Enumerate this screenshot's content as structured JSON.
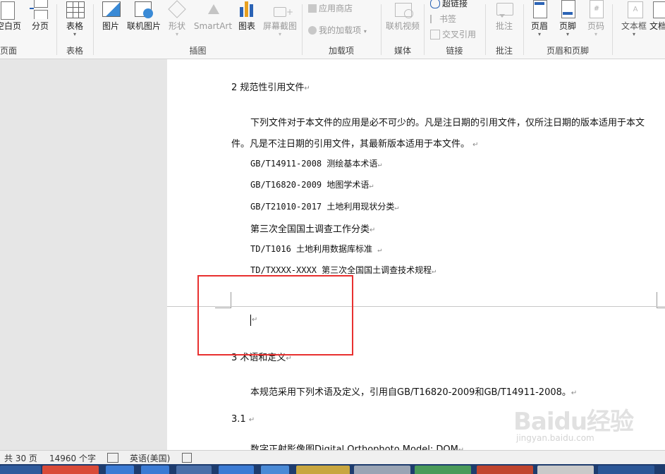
{
  "ribbon": {
    "groups": {
      "pages": {
        "label": "页面",
        "blank_page": "空白页",
        "page_break": "分页"
      },
      "table": {
        "label": "表格",
        "table": "表格"
      },
      "illustrations": {
        "label": "插图",
        "picture": "图片",
        "online_picture": "联机图片",
        "shapes": "形状",
        "smartart": "SmartArt",
        "chart": "图表",
        "screenshot": "屏幕截图"
      },
      "addins": {
        "label": "加载项",
        "store": "应用商店",
        "my_addins": "我的加载项"
      },
      "media": {
        "label": "媒体",
        "online_video": "联机视频"
      },
      "links": {
        "label": "链接",
        "hyperlink": "超链接",
        "bookmark": "书签",
        "cross_reference": "交叉引用"
      },
      "comments": {
        "label": "批注",
        "comment": "批注"
      },
      "header_footer": {
        "label": "页眉和页脚",
        "header": "页眉",
        "footer": "页脚",
        "page_number": "页码"
      },
      "text": {
        "textbox": "文本框",
        "text_more": "文档"
      }
    }
  },
  "document": {
    "section2_heading": "2  规范性引用文件",
    "para1_line1": "下列文件对于本文件的应用是必不可少的。凡是注日期的引用文件，仅所注日期的版本适用于本文",
    "para1_line2": "件。凡是不注日期的引用文件，其最新版本适用于本文件。",
    "refs": [
      "GB/T14911-2008 测绘基本术语",
      "GB/T16820-2009 地图学术语",
      "GB/T21010-2017 土地利用现状分类",
      "第三次全国国土调查工作分类",
      "TD/T1016 土地利用数据库标准 ",
      "TD/TXXXX-XXXX 第三次全国国土调查技术规程"
    ],
    "section3_heading": "3  术语和定义",
    "para2": "本规范采用下列术语及定义，引用自GB/T16820-2009和GB/T14911-2008。",
    "section31": "3.1  ",
    "term1": "数字正射影像图Digital Orthophoto Model: DOM",
    "para_mark": "↵"
  },
  "status": {
    "pages": "共 30 页",
    "words": "14960 个字",
    "language": "英语(美国)"
  },
  "watermark": {
    "brand": "Baidu经验",
    "url": "jingyan.baidu.com"
  },
  "colors": {
    "highlight_box": "#e8302f",
    "taskbar": "#1e3c6e"
  }
}
